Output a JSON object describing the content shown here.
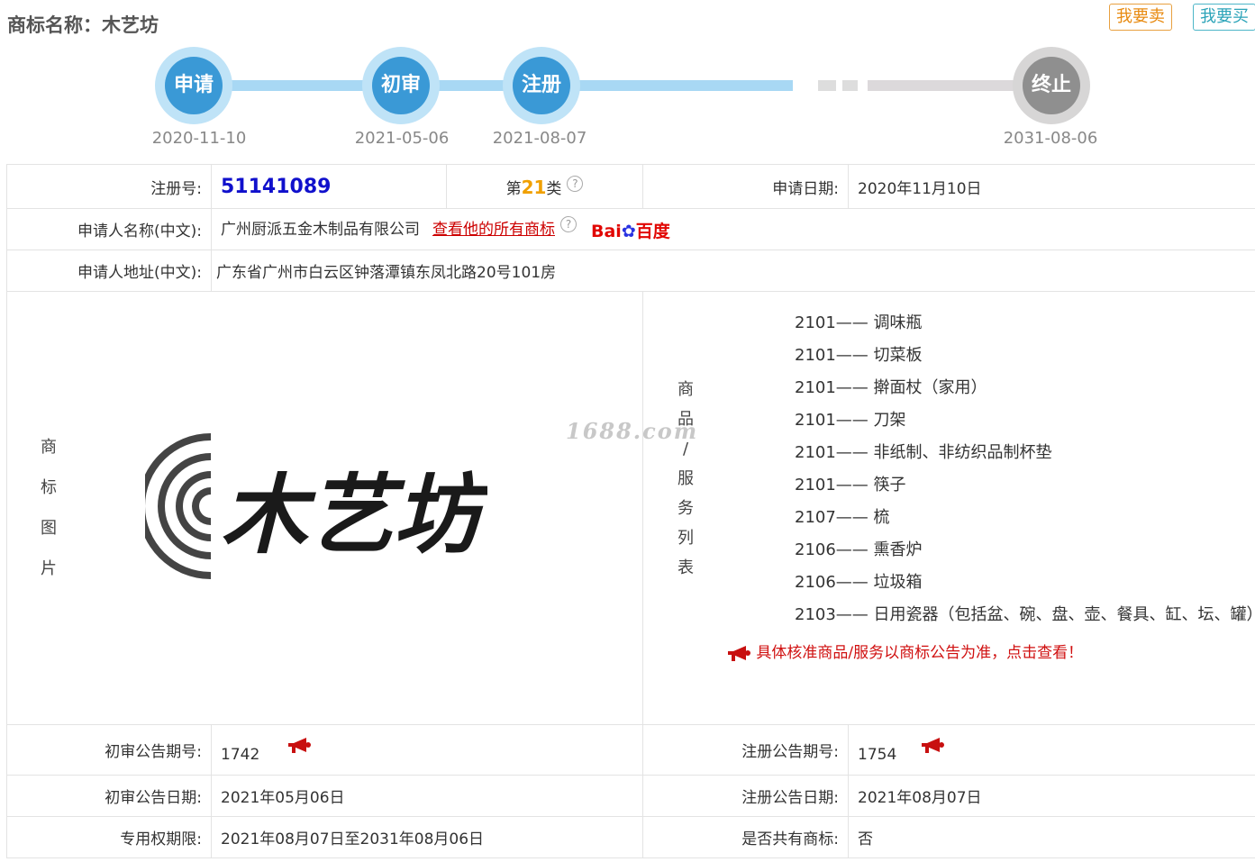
{
  "header": {
    "title": "商标名称：木艺坊",
    "sell_label": "我要卖",
    "buy_label": "我要买"
  },
  "timeline": [
    {
      "label": "申请",
      "date": "2020-11-10"
    },
    {
      "label": "初审",
      "date": "2021-05-06"
    },
    {
      "label": "注册",
      "date": "2021-08-07"
    },
    {
      "label": "终止",
      "date": "2031-08-06"
    }
  ],
  "info": {
    "reg_no_label": "注册号:",
    "reg_no": "51141089",
    "class_prefix": "第",
    "class_num": "21",
    "class_suffix": "类",
    "apply_date_label": "申请日期:",
    "apply_date": "2020年11月10日",
    "applicant_label": "申请人名称(中文):",
    "applicant": "广州厨派五金木制品有限公司",
    "all_marks_link": "查看他的所有商标",
    "baidu_a": "Bai",
    "baidu_b": "百度",
    "address_label": "申请人地址(中文):",
    "address": "广东省广州市白云区钟落潭镇东凤北路20号101房",
    "image_label_chars": [
      "商",
      "标",
      "图",
      "片"
    ],
    "goods_label_chars": [
      "商",
      "品",
      "/",
      "服",
      "务",
      "列",
      "表"
    ],
    "mark_text": "木艺坊",
    "watermark": "1688.com",
    "goods": [
      "2101—— 调味瓶",
      "2101—— 切菜板",
      "2101—— 擀面杖（家用）",
      "2101—— 刀架",
      "2101—— 非纸制、非纺织品制杯垫",
      "2101—— 筷子",
      "2107—— 梳",
      "2106—— 熏香炉",
      "2106—— 垃圾箱",
      "2103—— 日用瓷器（包括盆、碗、盘、壶、餐具、缸、坛、罐）"
    ],
    "notice": "具体核准商品/服务以商标公告为准，点击查看！",
    "prelim_issue_label": "初审公告期号:",
    "prelim_issue": "1742",
    "reg_issue_label": "注册公告期号:",
    "reg_issue": "1754",
    "prelim_date_label": "初审公告日期:",
    "prelim_date": "2021年05月06日",
    "reg_date_label": "注册公告日期:",
    "reg_date": "2021年08月07日",
    "term_label": "专用权期限:",
    "term": "2021年08月07日至2031年08月06日",
    "shared_label": "是否共有商标:",
    "shared": "否"
  }
}
